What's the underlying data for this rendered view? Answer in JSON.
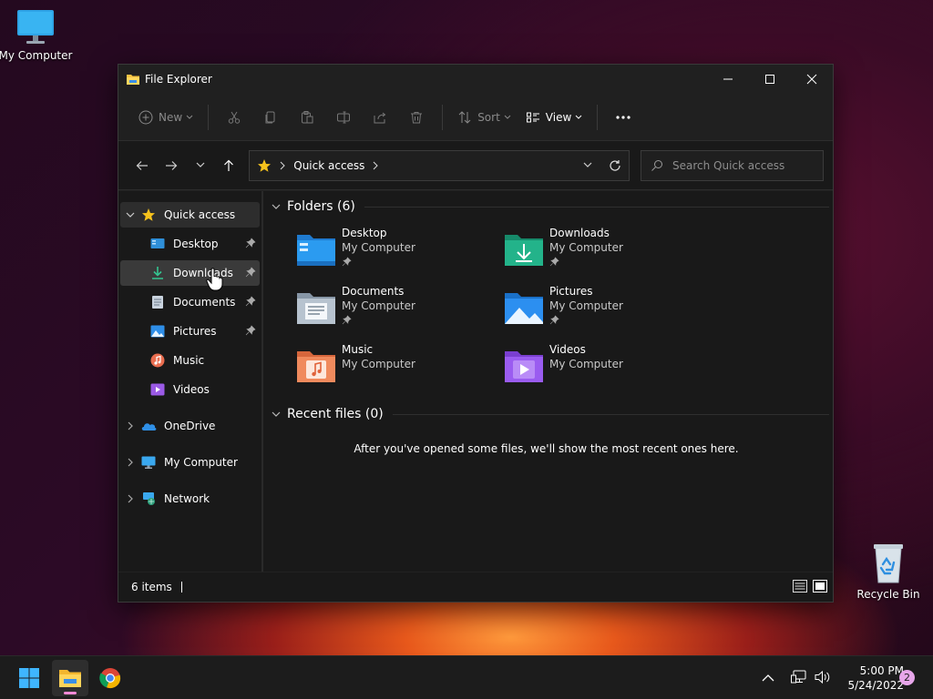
{
  "desktop": {
    "icons": [
      {
        "label": "My Computer",
        "icon": "monitor-icon"
      },
      {
        "label": "Recycle Bin",
        "icon": "recycle-bin-icon"
      }
    ]
  },
  "window": {
    "title": "File Explorer",
    "controls": {
      "minimize": "minimize-icon",
      "maximize": "maximize-icon",
      "close": "close-icon"
    }
  },
  "commandbar": {
    "new_label": "New",
    "sort_label": "Sort",
    "view_label": "View",
    "icons": [
      "cut-icon",
      "copy-icon",
      "paste-icon",
      "rename-icon",
      "share-icon",
      "delete-icon"
    ]
  },
  "navigation": {
    "address": {
      "location": "Quick access"
    },
    "search": {
      "placeholder": "Search Quick access"
    }
  },
  "sidebar": {
    "items": [
      {
        "label": "Quick access",
        "icon": "star-icon",
        "expanded": true
      },
      {
        "label": "Desktop",
        "icon": "desktop-folder-icon",
        "pinned": true
      },
      {
        "label": "Downloads",
        "icon": "download-icon",
        "pinned": true
      },
      {
        "label": "Documents",
        "icon": "documents-icon",
        "pinned": true
      },
      {
        "label": "Pictures",
        "icon": "pictures-icon",
        "pinned": true
      },
      {
        "label": "Music",
        "icon": "music-icon"
      },
      {
        "label": "Videos",
        "icon": "videos-icon"
      },
      {
        "label": "OneDrive",
        "icon": "onedrive-icon"
      },
      {
        "label": "My Computer",
        "icon": "monitor-icon"
      },
      {
        "label": "Network",
        "icon": "network-icon"
      }
    ]
  },
  "content": {
    "folders_header": "Folders (6)",
    "folders": [
      {
        "name": "Desktop",
        "location": "My Computer",
        "pinned": true,
        "icon": "desktop-folder-icon"
      },
      {
        "name": "Downloads",
        "location": "My Computer",
        "pinned": true,
        "icon": "downloads-folder-icon"
      },
      {
        "name": "Documents",
        "location": "My Computer",
        "pinned": true,
        "icon": "documents-folder-icon"
      },
      {
        "name": "Pictures",
        "location": "My Computer",
        "pinned": true,
        "icon": "pictures-folder-icon"
      },
      {
        "name": "Music",
        "location": "My Computer",
        "pinned": false,
        "icon": "music-folder-icon"
      },
      {
        "name": "Videos",
        "location": "My Computer",
        "pinned": false,
        "icon": "videos-folder-icon"
      }
    ],
    "recent_header": "Recent files (0)",
    "recent_empty": "After you've opened some files, we'll show the most recent ones here."
  },
  "statusbar": {
    "items_count": "6 items"
  },
  "taskbar": {
    "apps": [
      "windows-start-icon",
      "file-explorer-icon",
      "chrome-icon"
    ],
    "clock": {
      "time": "5:00 PM",
      "date": "5/24/2022"
    },
    "notification_count": "2"
  }
}
